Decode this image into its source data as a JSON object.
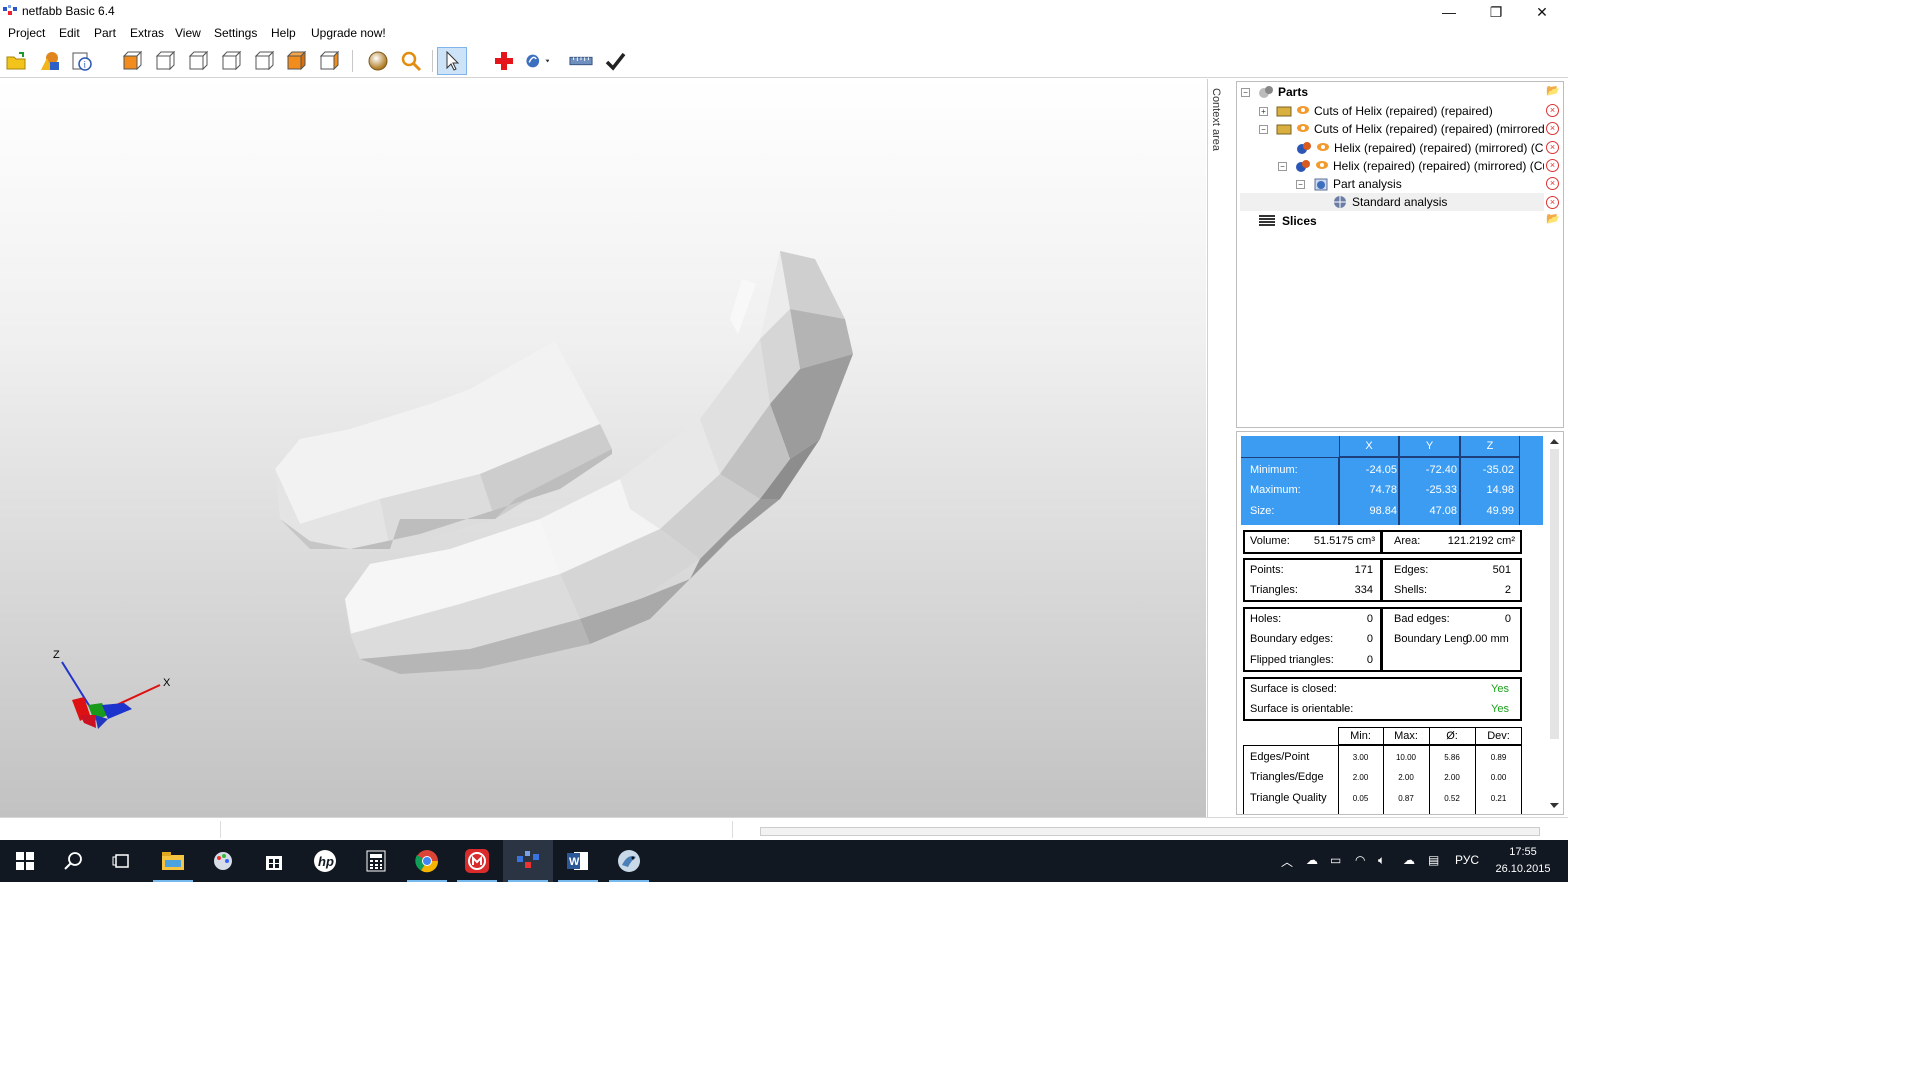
{
  "window": {
    "title": "netfabb Basic 6.4",
    "controls": {
      "minimize": "—",
      "restore": "❐",
      "close": "✕"
    }
  },
  "menu": [
    "Project",
    "Edit",
    "Part",
    "Extras",
    "View",
    "Settings",
    "Help",
    "Upgrade now!"
  ],
  "toolbar": {
    "icons": [
      "open-project-icon",
      "add-part-icon",
      "part-info-icon",
      "view-front-icon",
      "view-back-icon",
      "view-left-icon",
      "view-right-icon",
      "view-top-icon",
      "view-bottom-icon",
      "view-perspective-icon",
      "shading-sphere-icon",
      "zoom-icon",
      "select-arrow-icon",
      "repair-cross-icon",
      "analysis-icon",
      "measure-ruler-icon",
      "apply-check-icon"
    ]
  },
  "viewport": {
    "axes": {
      "x": "X",
      "z": "Z"
    },
    "context_label": "Context area"
  },
  "tree": {
    "root": "Parts",
    "items": [
      {
        "label": "Cuts of Helix (repaired) (repaired)",
        "expander": "+"
      },
      {
        "label": "Cuts of Helix (repaired) (repaired) (mirrored)",
        "expander": "−"
      },
      {
        "label": "Helix (repaired) (repaired) (mirrored) (Cut",
        "expander": ""
      },
      {
        "label": "Helix (repaired) (repaired) (mirrored) (Cut",
        "expander": "−"
      },
      {
        "label": "Part analysis",
        "expander": "−"
      },
      {
        "label": "Standard analysis",
        "expander": ""
      }
    ],
    "slices": "Slices"
  },
  "analysis": {
    "bbox": {
      "headers": [
        "X",
        "Y",
        "Z"
      ],
      "rows": [
        {
          "label": "Minimum:",
          "x": "-24.05",
          "y": "-72.40",
          "z": "-35.02"
        },
        {
          "label": "Maximum:",
          "x": "74.78",
          "y": "-25.33",
          "z": "14.98"
        },
        {
          "label": "Size:",
          "x": "98.84",
          "y": "47.08",
          "z": "49.99"
        }
      ]
    },
    "volume_label": "Volume:",
    "volume": "51.5175 cm³",
    "area_label": "Area:",
    "area": "121.2192 cm²",
    "points_label": "Points:",
    "points": "171",
    "edges_label": "Edges:",
    "edges": "501",
    "triangles_label": "Triangles:",
    "triangles": "334",
    "shells_label": "Shells:",
    "shells": "2",
    "holes_label": "Holes:",
    "holes": "0",
    "bad_edges_label": "Bad edges:",
    "bad_edges": "0",
    "boundary_edges_label": "Boundary edges:",
    "boundary_edges": "0",
    "boundary_length_label": "Boundary Leng",
    "boundary_length": "0.00 mm",
    "flipped_label": "Flipped triangles:",
    "flipped": "0",
    "closed_label": "Surface is closed:",
    "closed": "Yes",
    "orientable_label": "Surface is orientable:",
    "orientable": "Yes",
    "stats_headers": [
      "Min:",
      "Max:",
      "Ø:",
      "Dev:"
    ],
    "stats": [
      {
        "label": "Edges/Point",
        "min": "3.00",
        "max": "10.00",
        "avg": "5.86",
        "dev": "0.89"
      },
      {
        "label": "Triangles/Edge",
        "min": "2.00",
        "max": "2.00",
        "avg": "2.00",
        "dev": "0.00"
      },
      {
        "label": "Triangle Quality",
        "min": "0.05",
        "max": "0.87",
        "avg": "0.52",
        "dev": "0.21"
      }
    ]
  },
  "taskbar": {
    "apps": [
      "start-icon",
      "search-icon",
      "task-view-icon",
      "file-explorer-icon",
      "paint-app-icon",
      "store-icon",
      "hp-icon",
      "calculator-icon",
      "chrome-icon",
      "red-app-icon",
      "netfabb-icon",
      "word-icon",
      "parrot-app-icon"
    ],
    "language": "РУС",
    "time": "17:55",
    "date": "26.10.2015"
  }
}
